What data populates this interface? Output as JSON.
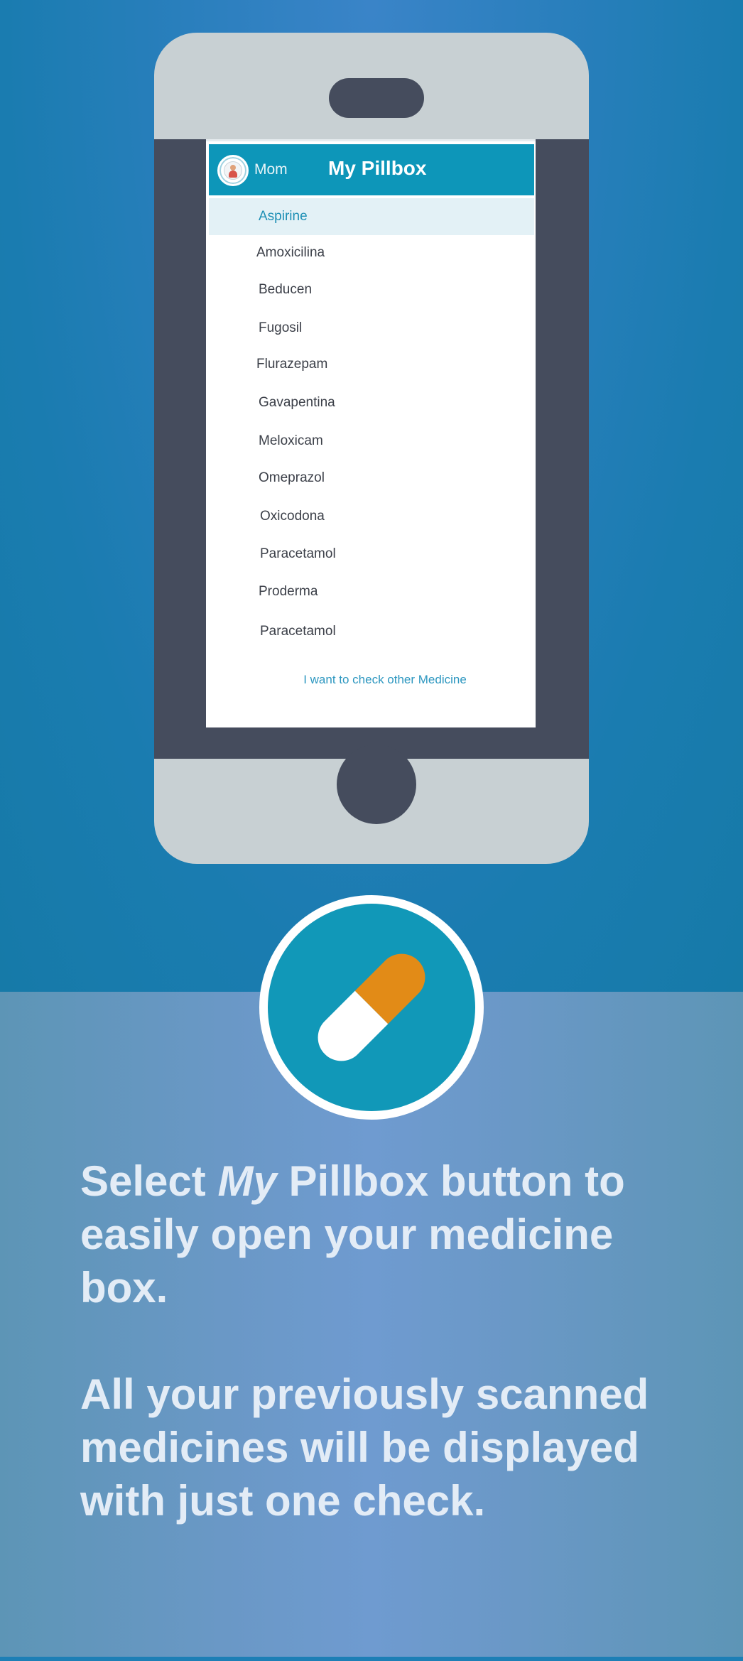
{
  "app": {
    "profile_name": "Mom",
    "title": "My Pillbox"
  },
  "medicines": [
    "Aspirine",
    "Amoxicilina",
    "Beducen",
    "Fugosil",
    "Flurazepam",
    "Gavapentina",
    "Meloxicam",
    "Omeprazol",
    "Oxicodona",
    "Paracetamol",
    "Proderma",
    "Paracetamol"
  ],
  "selected_index": 0,
  "footer_link": "I want to check other Medicine",
  "icons": {
    "avatar": "user-avatar-icon",
    "badge": "pill-capsule-icon"
  },
  "colors": {
    "header": "#0d96b9",
    "selected_row": "#e3f1f6",
    "capsule_orange": "#e28b17",
    "badge_teal": "#1198b8"
  },
  "description": {
    "line1_pre": "Select ",
    "line1_italic": "My",
    "line1_post": " Pillbox button",
    "line1_tail": " to",
    "line2": "easily open your medicine box.",
    "para2": "All your previously scanned medicines will be displayed with just one check."
  }
}
